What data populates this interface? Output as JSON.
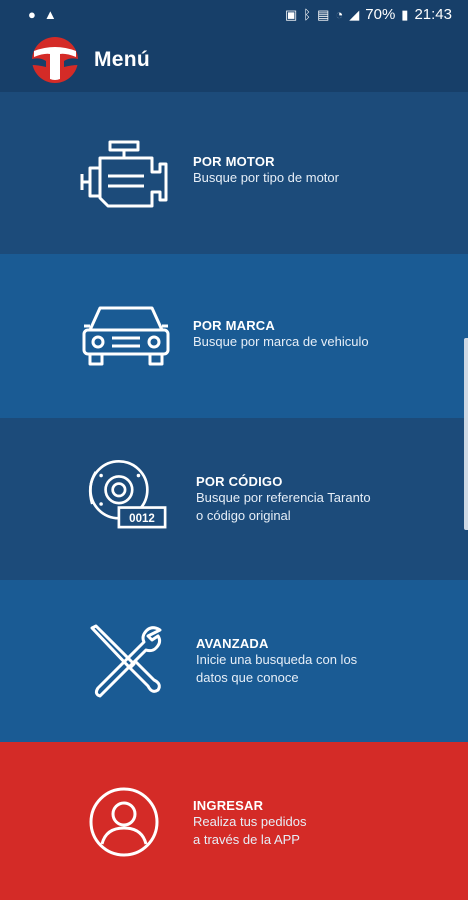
{
  "status_bar": {
    "battery_percent": "70%",
    "time": "21:43",
    "left_icons": [
      "spotify-icon",
      "warning-icon"
    ],
    "right_icons": [
      "image-icon",
      "bluetooth-icon",
      "nfc-icon",
      "wifi-icon",
      "signal-icon",
      "battery-icon"
    ]
  },
  "app_bar": {
    "title": "Menú"
  },
  "menu": {
    "items": [
      {
        "title": "POR MOTOR",
        "desc_line1": "Busque por tipo de motor",
        "desc_line2": "",
        "icon": "engine-icon"
      },
      {
        "title": "POR MARCA",
        "desc_line1": "Busque por marca de vehiculo",
        "desc_line2": "",
        "icon": "car-icon"
      },
      {
        "title": "POR CÓDIGO",
        "desc_line1": "Busque por referencia Taranto",
        "desc_line2": "o código original",
        "icon": "brake-code-icon",
        "code_label": "0012"
      },
      {
        "title": "AVANZADA",
        "desc_line1": "Inicie una busqueda con los",
        "desc_line2": "datos que conoce",
        "icon": "tools-icon"
      },
      {
        "title": "INGRESAR",
        "desc_line1": "Realiza tus pedidos",
        "desc_line2": "a través de la APP",
        "icon": "user-icon"
      }
    ]
  },
  "colors": {
    "app_bar": "#173f69",
    "item_dark": "#1c4b7a",
    "item_light": "#1a5b94",
    "item_login": "#d42b27",
    "logo_red": "#d42b27"
  }
}
